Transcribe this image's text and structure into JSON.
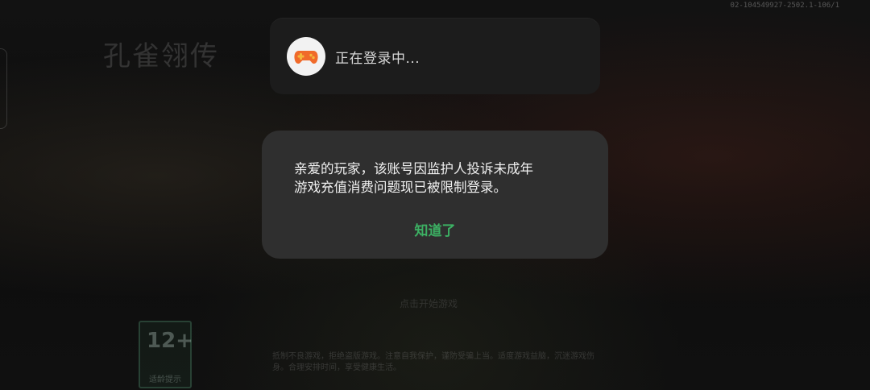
{
  "background": {
    "game_logo_text": "孔雀翎传",
    "version": "02-104549927-2502.1-106/1",
    "age_rating": "12+",
    "age_rating_label": "适龄提示",
    "hint": "点击开始游戏",
    "notice": "抵制不良游戏，拒绝盗版游戏。注意自我保护，谨防受骗上当。适度游戏益脑，沉迷游戏伤身。合理安排时间，享受健康生活。"
  },
  "login_toast": {
    "icon": "gamepad-icon",
    "text": "正在登录中..."
  },
  "alert_dialog": {
    "message_lines": [
      "亲爱的玩家，该账号因监护人投诉未成年",
      "游戏充值消费问题现已被限制登录。"
    ],
    "confirm_label": "知道了"
  },
  "colors": {
    "accent": "#3cb063",
    "dialog_bg": "#2f2f2f",
    "toast_bg": "#1c1c1c",
    "gamepad_orange": "#f06a2a",
    "gamepad_gold": "#f3b73c"
  }
}
